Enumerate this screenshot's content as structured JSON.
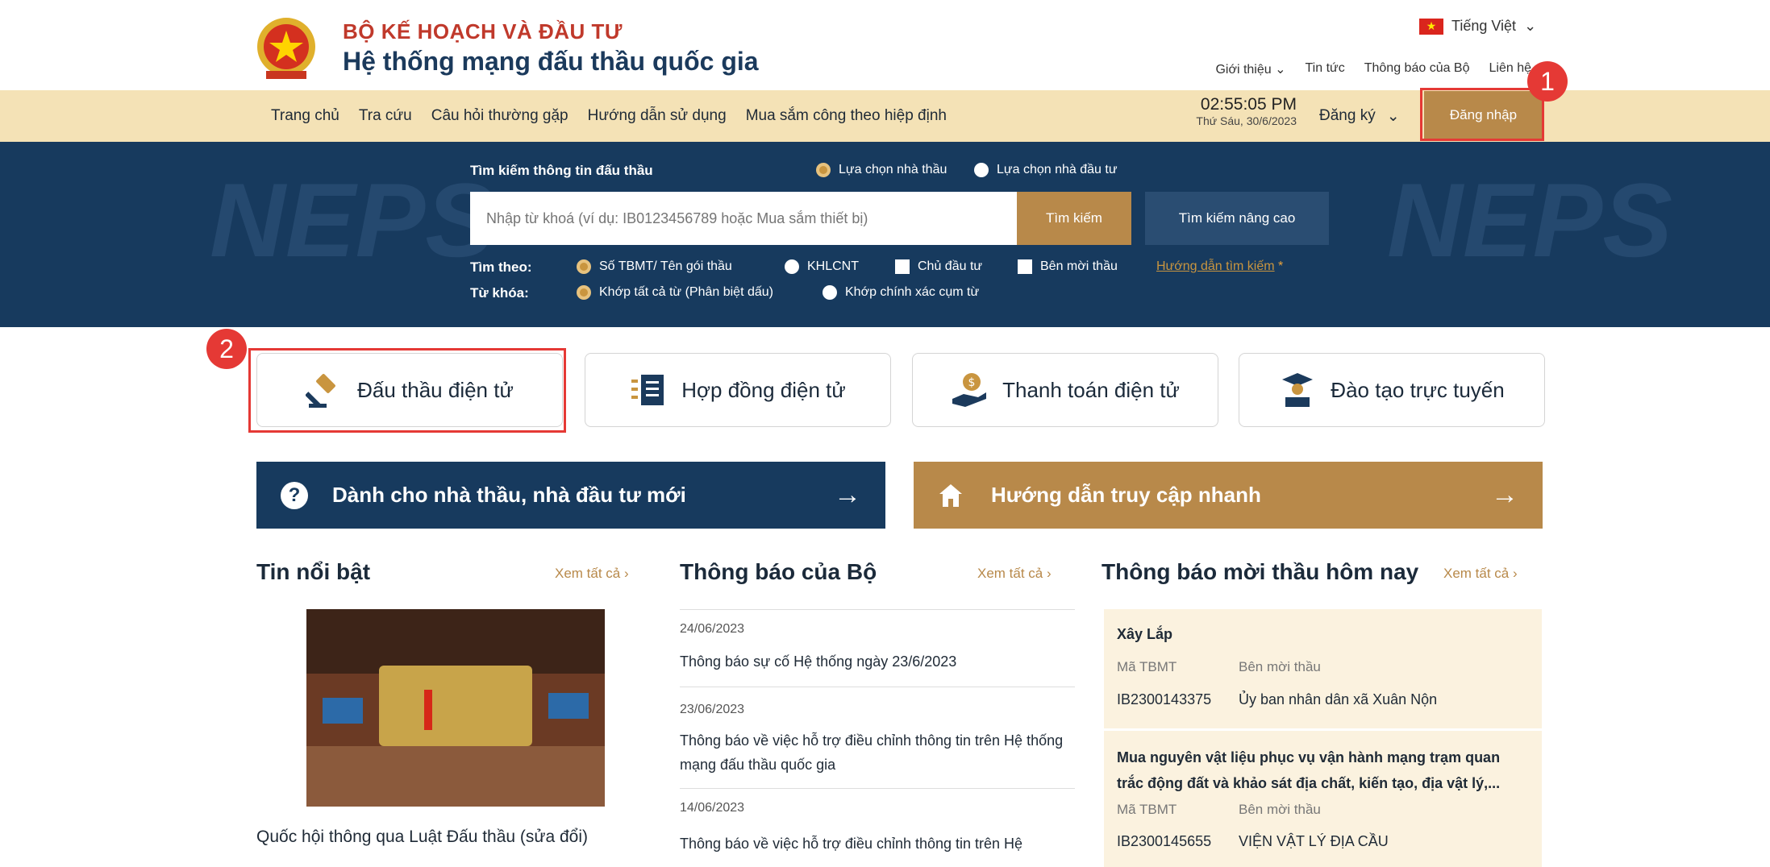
{
  "header": {
    "org_name": "BỘ KẾ HOẠCH VÀ ĐẦU TƯ",
    "system_name": "Hệ thống mạng đấu thầu quốc gia",
    "language": "Tiếng Việt",
    "top_links": [
      "Giới thiệu",
      "Tin tức",
      "Thông báo của Bộ",
      "Liên hệ"
    ]
  },
  "nav": {
    "items": [
      "Trang chủ",
      "Tra cứu",
      "Câu hỏi thường gặp",
      "Hướng dẫn sử dụng",
      "Mua sắm công theo hiệp định"
    ],
    "time": "02:55:05 PM",
    "date": "Thứ Sáu, 30/6/2023",
    "register": "Đăng ký",
    "login": "Đăng nhập"
  },
  "annotations": {
    "badge1": "1",
    "badge2": "2"
  },
  "search": {
    "title": "Tìm kiếm thông tin đấu thầu",
    "mode_contractor": "Lựa chọn nhà thầu",
    "mode_investor": "Lựa chọn nhà đầu tư",
    "placeholder": "Nhập từ khoá (ví dụ: IB0123456789 hoặc Mua sắm thiết bị)",
    "search_button": "Tìm kiếm",
    "advanced_button": "Tìm kiếm nâng cao",
    "by_label": "Tìm theo:",
    "by_options": [
      "Số TBMT/ Tên gói thầu",
      "KHLCNT",
      "Chủ đầu tư",
      "Bên mời thầu"
    ],
    "guide_link": "Hướng dẫn tìm kiếm",
    "guide_star": "*",
    "keyword_label": "Từ khóa:",
    "keyword_options": [
      "Khớp tất cả từ (Phân biệt dấu)",
      "Khớp chính xác cụm từ"
    ],
    "watermark": "NEPS"
  },
  "services": [
    {
      "label": "Đấu thầu điện tử",
      "icon": "gavel-icon"
    },
    {
      "label": "Hợp đồng điện tử",
      "icon": "contract-list-icon"
    },
    {
      "label": "Thanh toán điện tử",
      "icon": "payment-hand-icon"
    },
    {
      "label": "Đào tạo trực tuyến",
      "icon": "graduation-icon"
    }
  ],
  "banners": {
    "new_users": "Dành cho nhà thầu, nhà đầu tư mới",
    "quick_access": "Hướng dẫn truy cập nhanh",
    "arrow": "→"
  },
  "news": {
    "title": "Tin nổi bật",
    "view_all": "Xem tất cả",
    "headline": "Quốc hội thông qua Luật Đấu thầu (sửa đổi)"
  },
  "notices": {
    "title": "Thông báo của Bộ",
    "view_all": "Xem tất cả",
    "items": [
      {
        "date": "24/06/2023",
        "title": "Thông báo sự cố Hệ thống ngày 23/6/2023"
      },
      {
        "date": "23/06/2023",
        "title": "Thông báo về việc hỗ trợ điều chỉnh thông tin trên Hệ thống mạng đấu thầu quốc gia"
      },
      {
        "date": "14/06/2023",
        "title": "Thông báo về việc hỗ trợ điều chỉnh thông tin trên Hệ"
      }
    ]
  },
  "tenders": {
    "title": "Thông báo mời thầu hôm nay",
    "view_all": "Xem tất cả",
    "col_code": "Mã TBMT",
    "col_inviter": "Bên mời thầu",
    "items": [
      {
        "name": "Xây Lắp",
        "code": "IB2300143375",
        "inviter": "Ủy ban nhân dân xã Xuân Nộn"
      },
      {
        "name": "Mua nguyên vật liệu phục vụ vận hành mạng trạm quan trắc động đất và khảo sát địa chất, kiến tạo, địa vật lý,...",
        "code": "IB2300145655",
        "inviter": "VIỆN VẬT LÝ ĐỊA CẦU"
      }
    ]
  },
  "colors": {
    "navy": "#173a5e",
    "gold": "#b8894a",
    "cream": "#f4e2b6",
    "highlight": "#e53935"
  }
}
